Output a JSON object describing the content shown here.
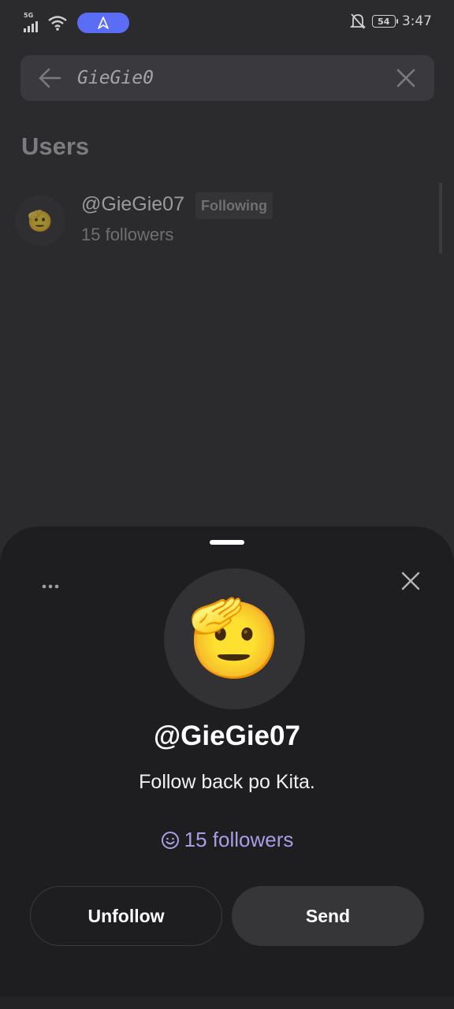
{
  "status_bar": {
    "network": "5G",
    "battery": "54",
    "time": "3:47",
    "icons": [
      "signal-icon",
      "wifi-icon",
      "navigation-icon",
      "bell-off-icon",
      "battery-icon"
    ]
  },
  "search": {
    "query": "GieGie0",
    "icons": [
      "back-arrow-icon",
      "clear-icon"
    ]
  },
  "results": {
    "section_title": "Users",
    "users": [
      {
        "handle": "@GieGie07",
        "badge": "Following",
        "followers": "15 followers",
        "avatar": "🫡"
      }
    ]
  },
  "profile_sheet": {
    "avatar": "🫡",
    "handle": "@GieGie07",
    "bio": "Follow back po Kita.",
    "followers": "15 followers",
    "unfollow_label": "Unfollow",
    "send_label": "Send",
    "accent_color": "#a89ee6"
  },
  "colors": {
    "background": "#2b2b2e",
    "sheet": "#1e1e20",
    "nav_pill": "#5b6cf5"
  }
}
